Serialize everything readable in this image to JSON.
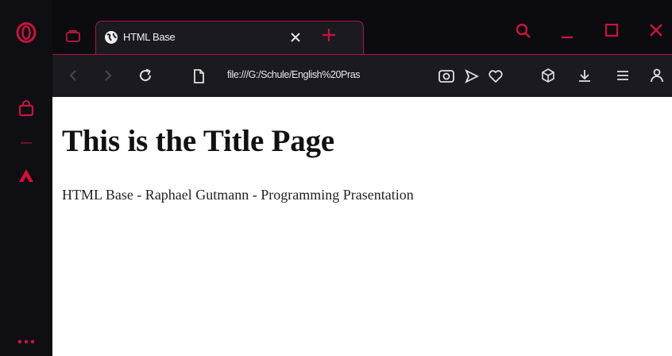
{
  "browser": {
    "tab": {
      "title": "HTML Base"
    },
    "address_bar": {
      "url": "file:///G:/Schule/English%20Pras"
    },
    "accent_color": "#b0153a",
    "icons": {
      "sidebar": [
        "opera-logo-icon",
        "shopping-bag-icon",
        "divider",
        "aria-icon",
        "more-dots-icon"
      ],
      "titlebar": [
        "workspace-icon",
        "globe-icon",
        "close-tab-icon",
        "new-tab-icon",
        "search-tabs-icon",
        "minimize-icon",
        "maximize-icon",
        "close-window-icon"
      ],
      "toolbar": [
        "back-icon",
        "forward-icon",
        "reload-icon",
        "page-info-icon",
        "snapshot-icon",
        "send-icon",
        "heart-icon",
        "extensions-icon",
        "download-icon",
        "menu-icon",
        "account-icon"
      ]
    }
  },
  "page": {
    "title": "This is the Title Page",
    "text": "HTML Base - Raphael Gutmann - Programming Prasentation"
  }
}
